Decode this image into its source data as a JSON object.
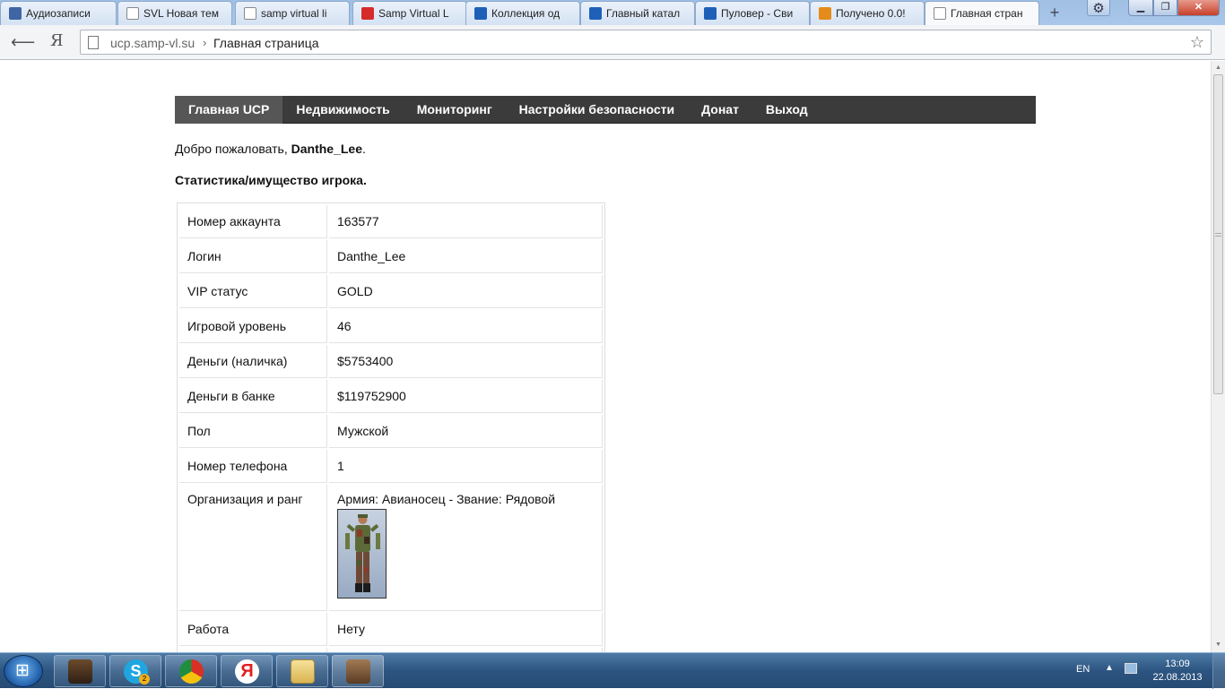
{
  "browser": {
    "tabs": [
      {
        "label": "Аудиозаписи",
        "icon": "vk-play-icon",
        "color": "#3f65a3"
      },
      {
        "label": "SVL Новая тем",
        "icon": "page-icon",
        "color": "#ffffff"
      },
      {
        "label": "samp virtual li",
        "icon": "yandex-icon",
        "color": "#ffffff"
      },
      {
        "label": "Samp Virtual L",
        "icon": "youtube-icon",
        "color": "#d62b2b"
      },
      {
        "label": "Коллекция од",
        "icon": "q-icon",
        "color": "#1e5fb8"
      },
      {
        "label": "Главный катал",
        "icon": "q-icon",
        "color": "#1e5fb8"
      },
      {
        "label": "Пуловер - Сви",
        "icon": "q-icon",
        "color": "#1e5fb8"
      },
      {
        "label": "Получено 0.0!",
        "icon": "mail-at-icon",
        "color": "#e48b1c"
      },
      {
        "label": "Главная стран",
        "icon": "page-icon",
        "color": "#ffffff"
      }
    ],
    "url_host": "ucp.samp-vl.su",
    "url_sep": "›",
    "url_title": "Главная страница",
    "yandex": "Я"
  },
  "nav": {
    "items": [
      "Главная UCP",
      "Недвижимость",
      "Мониторинг",
      "Настройки безопасности",
      "Донат",
      "Выход"
    ],
    "active": "Главная UCP"
  },
  "welcome": {
    "prefix": "Добро пожаловать, ",
    "username": "Danthe_Lee",
    "suffix": "."
  },
  "stats_heading": "Статистика/имущество игрока.",
  "stats": {
    "rows": [
      {
        "label": "Номер аккаунта",
        "value": "163577"
      },
      {
        "label": "Логин",
        "value": "Danthe_Lee"
      },
      {
        "label": "VIP статус",
        "value": "GOLD"
      },
      {
        "label": "Игровой уровень",
        "value": "46"
      },
      {
        "label": "Деньги (наличка)",
        "value": "$5753400"
      },
      {
        "label": "Деньги в банке",
        "value": "$119752900"
      },
      {
        "label": "Пол",
        "value": "Мужской"
      },
      {
        "label": "Номер телефона",
        "value": "1"
      }
    ],
    "org_label": "Организация и ранг",
    "org_value": "Армия: Авианосец - Звание: Рядовой",
    "job_label": "Работа",
    "job_value": "Нету"
  },
  "taskbar": {
    "lang": "EN",
    "time": "13:09",
    "date": "22.08.2013",
    "skype_badge": "2"
  }
}
